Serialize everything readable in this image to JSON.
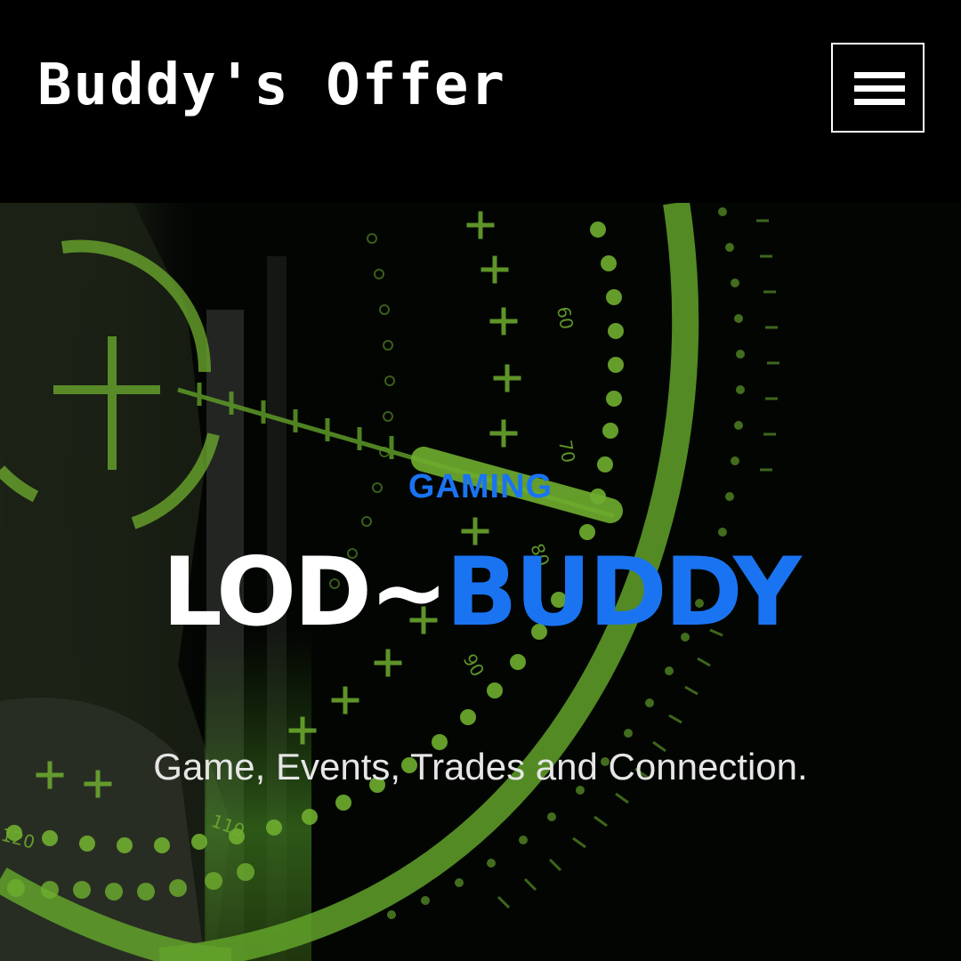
{
  "header": {
    "brand": "Buddy's Offer",
    "menu_icon": "hamburger-menu-icon"
  },
  "hero": {
    "kicker": "GAMING",
    "title_part1": "LOD~",
    "title_part2": "BUDDY",
    "tagline": "Game, Events, Trades and Connection.",
    "hud_numbers": [
      "60",
      "70",
      "80",
      "90",
      "120",
      "110"
    ],
    "colors": {
      "accent_blue": "#1a74f2",
      "hud_green": "#6fae2f",
      "background": "#000000",
      "text_white": "#ffffff"
    }
  }
}
